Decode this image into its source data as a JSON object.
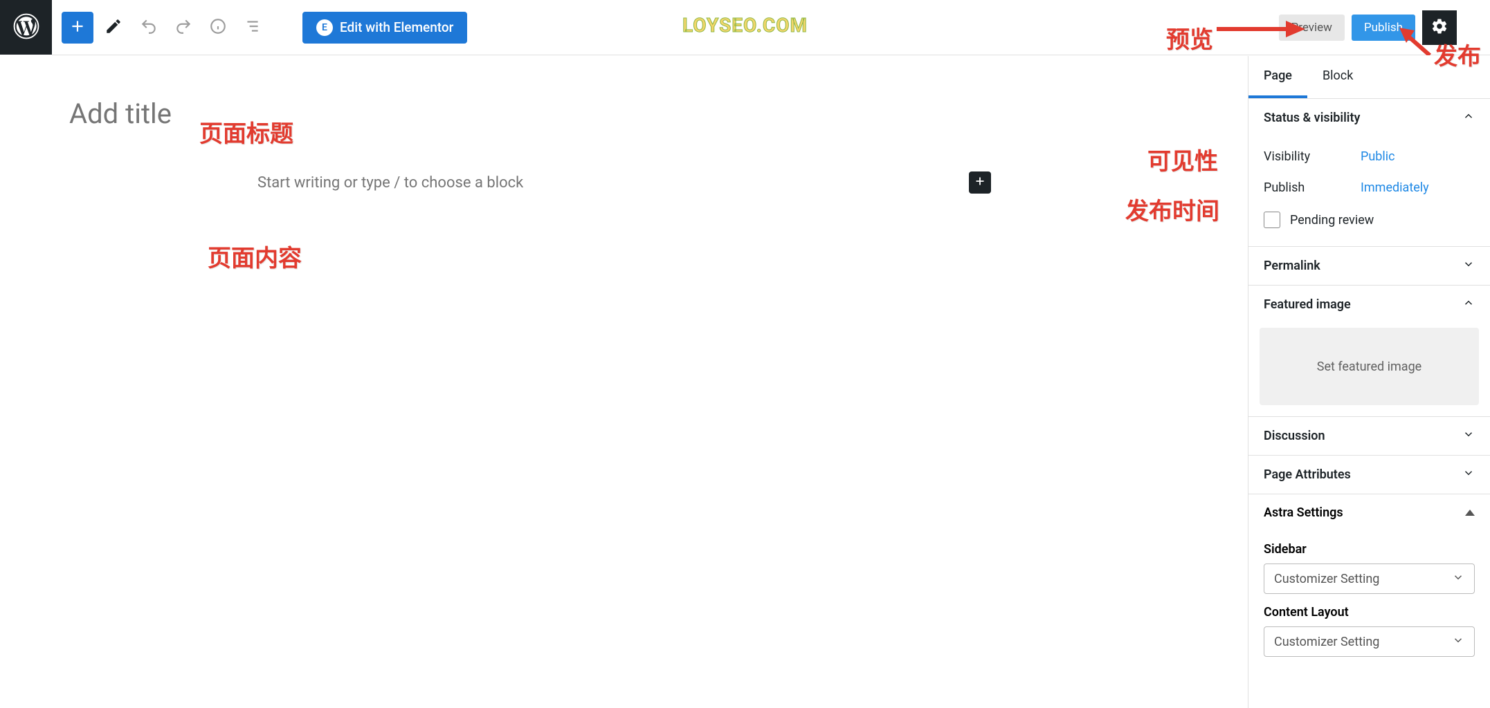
{
  "watermark": "LOYSEO.COM",
  "toolbar": {
    "elementor_label": "Edit with Elementor",
    "preview_label": "Preview",
    "publish_label": "Publish"
  },
  "editor": {
    "title_placeholder": "Add title",
    "content_placeholder": "Start writing or type / to choose a block"
  },
  "sidebar": {
    "tabs": {
      "page": "Page",
      "block": "Block"
    },
    "status": {
      "heading": "Status & visibility",
      "visibility_k": "Visibility",
      "visibility_v": "Public",
      "publish_k": "Publish",
      "publish_v": "Immediately",
      "pending_label": "Pending review"
    },
    "permalink": {
      "heading": "Permalink"
    },
    "featured": {
      "heading": "Featured image",
      "button_label": "Set featured image"
    },
    "discussion": {
      "heading": "Discussion"
    },
    "attributes": {
      "heading": "Page Attributes"
    },
    "astra": {
      "heading": "Astra Settings",
      "sidebar_label": "Sidebar",
      "sidebar_value": "Customizer Setting",
      "layout_label": "Content Layout",
      "layout_value": "Customizer Setting"
    }
  },
  "annotations": {
    "title": "页面标题",
    "content": "页面内容",
    "preview": "预览",
    "publish": "发布",
    "visibility": "可见性",
    "publish_time": "发布时间"
  }
}
